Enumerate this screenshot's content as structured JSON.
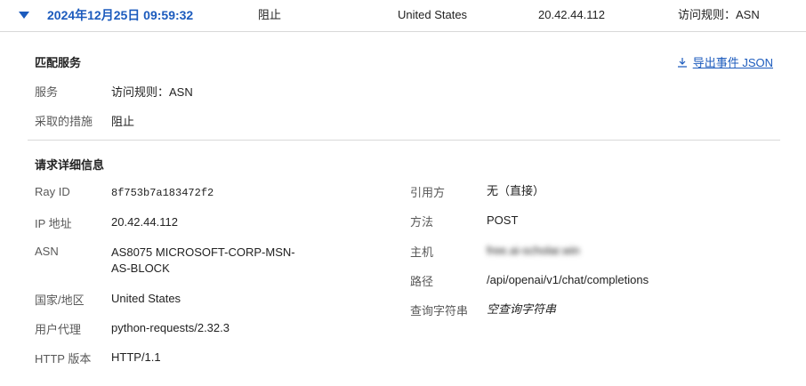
{
  "summary": {
    "timestamp": "2024年12月25日 09:59:32",
    "action": "阻止",
    "country": "United States",
    "ip": "20.42.44.112",
    "service": "访问规则：ASN"
  },
  "match_section": {
    "title": "匹配服务",
    "export_label": "导出事件 JSON",
    "fields": [
      {
        "label": "服务",
        "value": "访问规则：ASN"
      },
      {
        "label": "采取的措施",
        "value": "阻止"
      }
    ]
  },
  "request_section": {
    "title": "请求详细信息",
    "left": [
      {
        "label": "Ray ID",
        "value": "8f753b7a183472f2"
      },
      {
        "label": "IP 地址",
        "value": "20.42.44.112"
      },
      {
        "label": "ASN",
        "value": "AS8075 MICROSOFT-CORP-MSN-AS-BLOCK"
      },
      {
        "label": "国家/地区",
        "value": "United States"
      },
      {
        "label": "用户代理",
        "value": "python-requests/2.32.3"
      },
      {
        "label": "HTTP 版本",
        "value": "HTTP/1.1"
      }
    ],
    "right": [
      {
        "label": "引用方",
        "value": "无（直接）"
      },
      {
        "label": "方法",
        "value": "POST"
      },
      {
        "label": "主机",
        "value": "free.ai-scholar.win"
      },
      {
        "label": "路径",
        "value": "/api/openai/v1/chat/completions"
      },
      {
        "label": "查询字符串",
        "value": "空查询字符串"
      }
    ]
  },
  "colors": {
    "accent": "#1c5bbd",
    "label": "#595959",
    "divider": "#d9d9d9"
  },
  "icons": {
    "expand": "chevron-down-icon",
    "export": "download-icon"
  }
}
